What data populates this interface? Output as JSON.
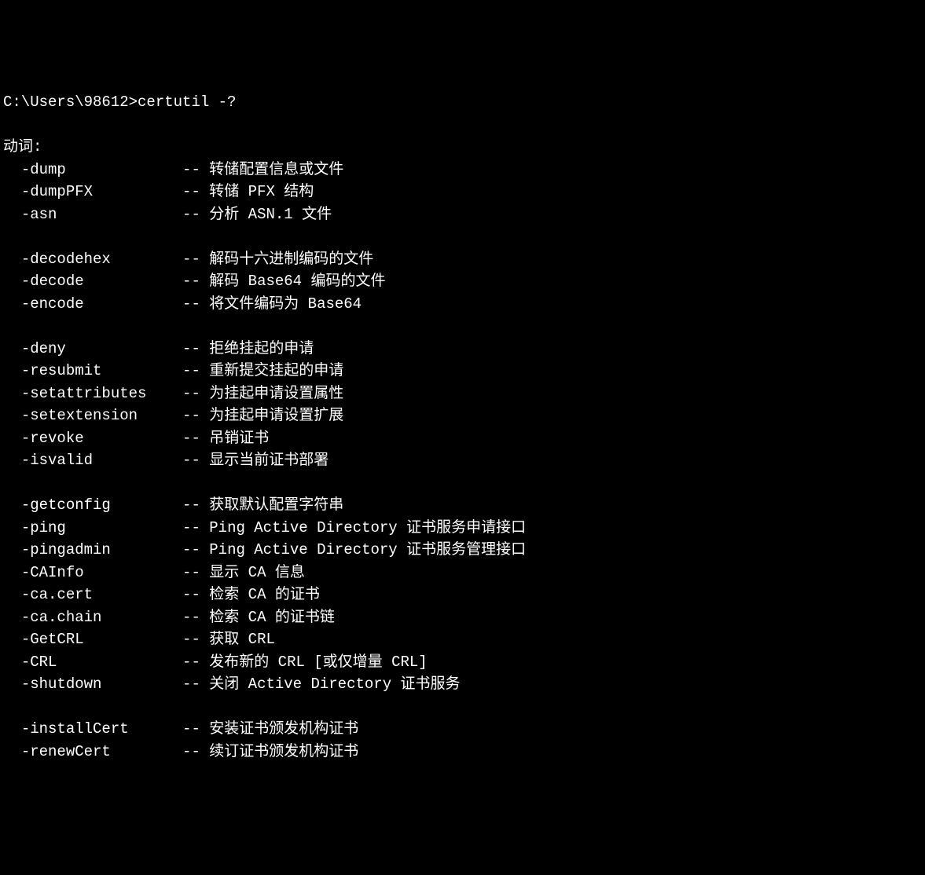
{
  "prompt": {
    "path": "C:\\Users\\98612>",
    "command": "certutil -?"
  },
  "header": "动词:",
  "groups": [
    [
      {
        "flag": "-dump",
        "desc": "转储配置信息或文件"
      },
      {
        "flag": "-dumpPFX",
        "desc": "转储 PFX 结构"
      },
      {
        "flag": "-asn",
        "desc": "分析 ASN.1 文件"
      }
    ],
    [
      {
        "flag": "-decodehex",
        "desc": "解码十六进制编码的文件"
      },
      {
        "flag": "-decode",
        "desc": "解码 Base64 编码的文件"
      },
      {
        "flag": "-encode",
        "desc": "将文件编码为 Base64"
      }
    ],
    [
      {
        "flag": "-deny",
        "desc": "拒绝挂起的申请"
      },
      {
        "flag": "-resubmit",
        "desc": "重新提交挂起的申请"
      },
      {
        "flag": "-setattributes",
        "desc": "为挂起申请设置属性"
      },
      {
        "flag": "-setextension",
        "desc": "为挂起申请设置扩展"
      },
      {
        "flag": "-revoke",
        "desc": "吊销证书"
      },
      {
        "flag": "-isvalid",
        "desc": "显示当前证书部署"
      }
    ],
    [
      {
        "flag": "-getconfig",
        "desc": "获取默认配置字符串"
      },
      {
        "flag": "-ping",
        "desc": "Ping Active Directory 证书服务申请接口"
      },
      {
        "flag": "-pingadmin",
        "desc": "Ping Active Directory 证书服务管理接口"
      },
      {
        "flag": "-CAInfo",
        "desc": "显示 CA 信息"
      },
      {
        "flag": "-ca.cert",
        "desc": "检索 CA 的证书"
      },
      {
        "flag": "-ca.chain",
        "desc": "检索 CA 的证书链"
      },
      {
        "flag": "-GetCRL",
        "desc": "获取 CRL"
      },
      {
        "flag": "-CRL",
        "desc": "发布新的 CRL [或仅增量 CRL]"
      },
      {
        "flag": "-shutdown",
        "desc": "关闭 Active Directory 证书服务"
      }
    ],
    [
      {
        "flag": "-installCert",
        "desc": "安装证书颁发机构证书"
      },
      {
        "flag": "-renewCert",
        "desc": "续订证书颁发机构证书"
      }
    ]
  ],
  "separator": "--"
}
